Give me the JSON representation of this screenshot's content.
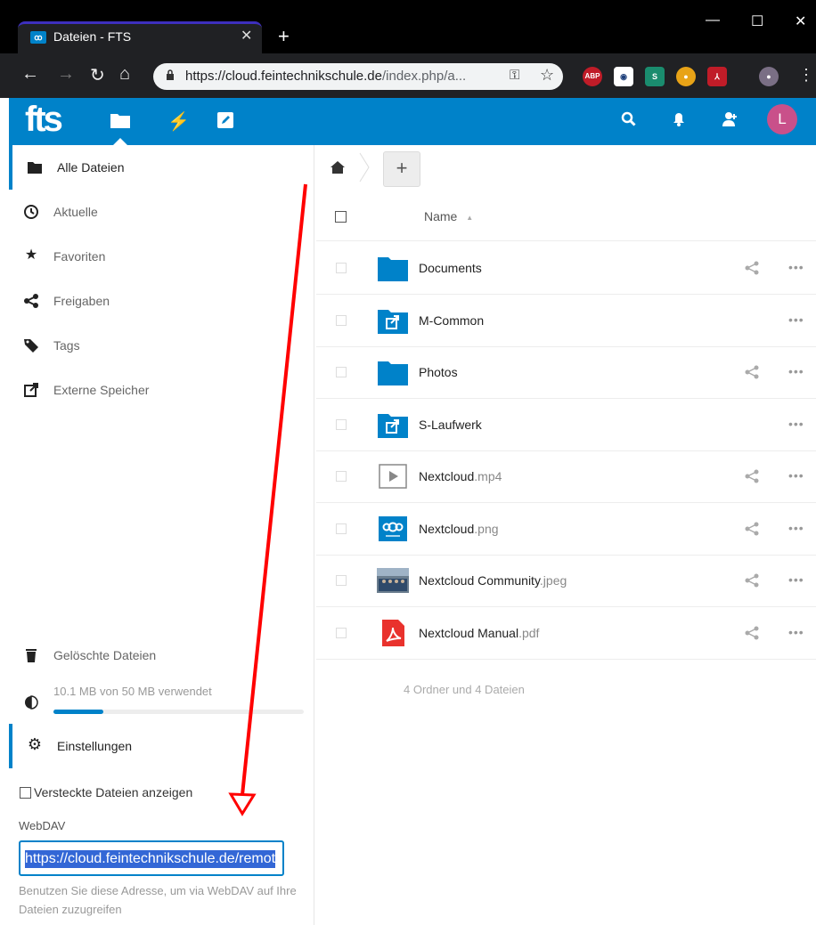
{
  "browser": {
    "tab_title": "Dateien - FTS",
    "tab_favicon": "ꝏ",
    "url_main": "https://cloud.feintechnikschule.de",
    "url_rest": "/index.php/a...",
    "ext_abp": "ABP"
  },
  "header": {
    "logo": "fts",
    "avatar_letter": "L",
    "accent": "#0082c9"
  },
  "sidebar": {
    "items": [
      {
        "label": "Alle Dateien",
        "icon": "folder-icon"
      },
      {
        "label": "Aktuelle",
        "icon": "clock-icon"
      },
      {
        "label": "Favoriten",
        "icon": "star-icon"
      },
      {
        "label": "Freigaben",
        "icon": "share-icon"
      },
      {
        "label": "Tags",
        "icon": "tag-icon"
      },
      {
        "label": "Externe Speicher",
        "icon": "external-icon"
      }
    ],
    "deleted": "Gelöschte Dateien",
    "quota_text": "10.1 MB von 50 MB verwendet",
    "quota_fraction": 0.2,
    "settings": "Einstellungen",
    "show_hidden": "Versteckte Dateien anzeigen",
    "webdav_label": "WebDAV",
    "webdav_value": "https://cloud.feintechnikschule.de/remot",
    "webdav_hint": "Benutzen Sie diese Adresse, um via WebDAV auf Ihre Dateien zuzugreifen"
  },
  "files": {
    "column_name": "Name",
    "sort_indicator": "▲",
    "rows": [
      {
        "name": "Documents",
        "ext": "",
        "type": "folder",
        "shared": true
      },
      {
        "name": "M-Common",
        "ext": "",
        "type": "external",
        "shared": false
      },
      {
        "name": "Photos",
        "ext": "",
        "type": "folder",
        "shared": true
      },
      {
        "name": "S-Laufwerk",
        "ext": "",
        "type": "external",
        "shared": false
      },
      {
        "name": "Nextcloud",
        "ext": ".mp4",
        "type": "video",
        "shared": true
      },
      {
        "name": "Nextcloud",
        "ext": ".png",
        "type": "image-png",
        "shared": true
      },
      {
        "name": "Nextcloud Community",
        "ext": ".jpeg",
        "type": "image-jpeg",
        "shared": true
      },
      {
        "name": "Nextcloud Manual",
        "ext": ".pdf",
        "type": "pdf",
        "shared": true
      }
    ],
    "summary": "4 Ordner und 4 Dateien",
    "add_label": "+"
  }
}
